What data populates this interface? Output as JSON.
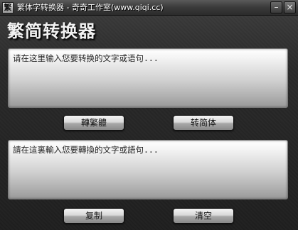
{
  "window": {
    "icon_glyph": "繁",
    "title": "繁体字转换器 - 奇奇工作室(www.qiqi.cc)",
    "minimize_glyph": "–",
    "close_glyph": "×"
  },
  "header": {
    "heading": "繁简转换器"
  },
  "input": {
    "placeholder": "请在这里输入您要转换的文字或语句..."
  },
  "convert": {
    "to_traditional_label": "轉繁體",
    "to_simplified_label": "转简体"
  },
  "output": {
    "placeholder": "請在這裏輸入您要轉換的文字或語句..."
  },
  "actions": {
    "copy_label": "复制",
    "clear_label": "清空"
  }
}
